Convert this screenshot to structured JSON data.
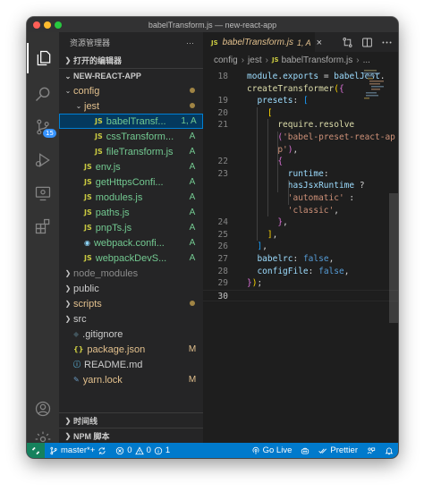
{
  "window": {
    "title": "babelTransform.js — new-react-app"
  },
  "traffic_colors": [
    "#ff5f57",
    "#febc2e",
    "#28c840"
  ],
  "activity": {
    "items": [
      "explorer-icon",
      "search-icon",
      "source-control-icon",
      "run-debug-icon",
      "remote-explorer-icon",
      "extensions-icon"
    ],
    "scm_badge": "15",
    "bottom": [
      "account-icon",
      "manage-gear-icon"
    ]
  },
  "sidebar": {
    "title": "资源管理器",
    "more": "···",
    "open_editors": "打开的编辑器",
    "project": "NEW-REACT-APP",
    "tree": [
      {
        "label": "config",
        "type": "folder",
        "open": true,
        "indent": 0,
        "status_dot": true
      },
      {
        "label": "jest",
        "type": "folder",
        "open": true,
        "indent": 1,
        "status_dot": true
      },
      {
        "label": "babelTransf...",
        "type": "js",
        "indent": 2,
        "status": "1, A",
        "focused": true
      },
      {
        "label": "cssTransform...",
        "type": "js",
        "indent": 2,
        "status": "A"
      },
      {
        "label": "fileTransform.js",
        "type": "js",
        "indent": 2,
        "status": "A"
      },
      {
        "label": "env.js",
        "type": "js",
        "indent": 1,
        "status": "A"
      },
      {
        "label": "getHttpsConfi...",
        "type": "js",
        "indent": 1,
        "status": "A"
      },
      {
        "label": "modules.js",
        "type": "js",
        "indent": 1,
        "status": "A"
      },
      {
        "label": "paths.js",
        "type": "js",
        "indent": 1,
        "status": "A"
      },
      {
        "label": "pnpTs.js",
        "type": "js",
        "indent": 1,
        "status": "A"
      },
      {
        "label": "webpack.confi...",
        "type": "web",
        "indent": 1,
        "status": "A"
      },
      {
        "label": "webpackDevS...",
        "type": "js",
        "indent": 1,
        "status": "A"
      },
      {
        "label": "node_modules",
        "type": "folder",
        "open": false,
        "indent": 0,
        "dim": true
      },
      {
        "label": "public",
        "type": "folder",
        "open": false,
        "indent": 0
      },
      {
        "label": "scripts",
        "type": "folder",
        "open": false,
        "indent": 0,
        "status_dot": true
      },
      {
        "label": "src",
        "type": "folder",
        "open": false,
        "indent": 0
      },
      {
        "label": ".gitignore",
        "type": "gitignore",
        "indent": 0
      },
      {
        "label": "package.json",
        "type": "json",
        "indent": 0,
        "status": "M"
      },
      {
        "label": "README.md",
        "type": "info",
        "indent": 0
      },
      {
        "label": "yarn.lock",
        "type": "yarn",
        "indent": 0,
        "status": "M"
      }
    ],
    "timeline": "时间线",
    "npm_scripts": "NPM 脚本"
  },
  "editor": {
    "tab": {
      "icon": "JS",
      "name": "babelTransform.js",
      "status": "1, A",
      "close": "×"
    },
    "tab_actions": [
      "open-changes-icon",
      "split-editor-icon",
      "more-actions-icon"
    ],
    "breadcrumb": [
      "config",
      "jest",
      "babelTransform.js",
      "..."
    ],
    "lines": [
      {
        "n": "18",
        "tokens": [
          [
            "k-var",
            "module"
          ],
          [
            "k-op",
            "."
          ],
          [
            "k-var",
            "exports"
          ],
          [
            "k-op",
            " = "
          ],
          [
            "k-var",
            "babelJest"
          ],
          [
            "k-op",
            "."
          ]
        ]
      },
      {
        "n": "",
        "tokens": [
          [
            "k-fn",
            "createTransformer"
          ],
          [
            "b1",
            "("
          ],
          [
            "b2",
            "{"
          ]
        ]
      },
      {
        "n": "19",
        "tokens": [
          [
            "k-op",
            "  "
          ],
          [
            "k-var",
            "presets"
          ],
          [
            "k-op",
            ": "
          ],
          [
            "b3",
            "["
          ]
        ]
      },
      {
        "n": "20",
        "tokens": [
          [
            "k-op",
            "    "
          ],
          [
            "b1",
            "["
          ]
        ]
      },
      {
        "n": "21",
        "tokens": [
          [
            "k-op",
            "      "
          ],
          [
            "k-fn",
            "require"
          ],
          [
            "k-op",
            "."
          ],
          [
            "k-fn",
            "resolve"
          ]
        ]
      },
      {
        "n": "",
        "tokens": [
          [
            "k-op",
            "      "
          ],
          [
            "b2",
            "("
          ],
          [
            "k-str",
            "'babel-preset-react-ap"
          ]
        ]
      },
      {
        "n": "",
        "tokens": [
          [
            "k-op",
            "      "
          ],
          [
            "k-str",
            "p'"
          ],
          [
            "b2",
            ")"
          ],
          [
            "k-op",
            ","
          ]
        ]
      },
      {
        "n": "22",
        "tokens": [
          [
            "k-op",
            "      "
          ],
          [
            "b2",
            "{"
          ]
        ]
      },
      {
        "n": "23",
        "tokens": [
          [
            "k-op",
            "        "
          ],
          [
            "k-var",
            "runtime"
          ],
          [
            "k-op",
            ":"
          ]
        ]
      },
      {
        "n": "",
        "tokens": [
          [
            "k-op",
            "        "
          ],
          [
            "k-var",
            "hasJsxRuntime"
          ],
          [
            "k-op",
            " ?"
          ]
        ]
      },
      {
        "n": "",
        "tokens": [
          [
            "k-op",
            "        "
          ],
          [
            "k-str",
            "'automatic'"
          ],
          [
            "k-op",
            " :"
          ]
        ]
      },
      {
        "n": "",
        "tokens": [
          [
            "k-op",
            "        "
          ],
          [
            "k-str",
            "'classic'"
          ],
          [
            "k-op",
            ","
          ]
        ]
      },
      {
        "n": "24",
        "tokens": [
          [
            "k-op",
            "      "
          ],
          [
            "b2",
            "}"
          ],
          [
            "k-op",
            ","
          ]
        ]
      },
      {
        "n": "25",
        "tokens": [
          [
            "k-op",
            "    "
          ],
          [
            "b1",
            "]"
          ],
          [
            "k-op",
            ","
          ]
        ]
      },
      {
        "n": "26",
        "tokens": [
          [
            "k-op",
            "  "
          ],
          [
            "b3",
            "]"
          ],
          [
            "k-op",
            ","
          ]
        ]
      },
      {
        "n": "27",
        "tokens": [
          [
            "k-op",
            "  "
          ],
          [
            "k-var",
            "babelrc"
          ],
          [
            "k-op",
            ": "
          ],
          [
            "k-kw",
            "false"
          ],
          [
            "k-op",
            ","
          ]
        ]
      },
      {
        "n": "28",
        "tokens": [
          [
            "k-op",
            "  "
          ],
          [
            "k-var",
            "configFile"
          ],
          [
            "k-op",
            ": "
          ],
          [
            "k-kw",
            "false"
          ],
          [
            "k-op",
            ","
          ]
        ]
      },
      {
        "n": "29",
        "tokens": [
          [
            "b2",
            "}"
          ],
          [
            "b1",
            ")"
          ],
          [
            "k-op",
            ";"
          ]
        ]
      },
      {
        "n": "30",
        "tokens": [],
        "current": true
      }
    ]
  },
  "statusbar": {
    "remote_icon": "remote-icon",
    "branch": "master*+",
    "errors": "0",
    "warnings": "0",
    "info": "1",
    "golive": "Go Live",
    "prettier": "Prettier",
    "accent": "#007acc"
  }
}
